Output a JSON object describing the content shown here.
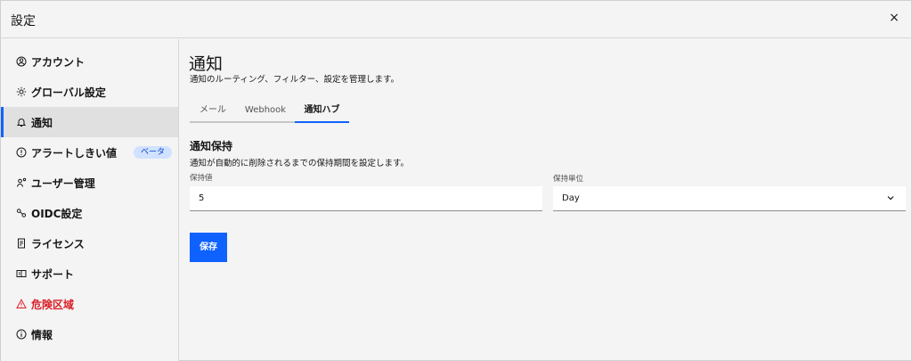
{
  "window": {
    "title": "設定",
    "close_label": "×"
  },
  "sidebar": {
    "items": [
      {
        "label": "アカウント"
      },
      {
        "label": "グローバル設定"
      },
      {
        "label": "通知"
      },
      {
        "label": "アラートしきい値",
        "badge": "ベータ"
      },
      {
        "label": "ユーザー管理"
      },
      {
        "label": "OIDC設定"
      },
      {
        "label": "ライセンス"
      },
      {
        "label": "サポート"
      },
      {
        "label": "危険区域"
      },
      {
        "label": "情報"
      }
    ],
    "active_index": 2
  },
  "main": {
    "title": "通知",
    "description": "通知のルーティング、フィルター、設定を管理します。",
    "tabs": [
      {
        "label": "メール"
      },
      {
        "label": "Webhook"
      },
      {
        "label": "通知ハブ"
      }
    ],
    "active_tab": 2,
    "section": {
      "title": "通知保持",
      "description": "通知が自動的に削除されるまでの保持期間を設定します。",
      "retention_value_label": "保持値",
      "retention_value": "5",
      "retention_unit_label": "保持単位",
      "retention_unit": "Day"
    },
    "save_label": "保存"
  },
  "colors": {
    "accent": "#0f62fe",
    "danger": "#da1e28",
    "badge_bg": "#d0e2ff"
  }
}
